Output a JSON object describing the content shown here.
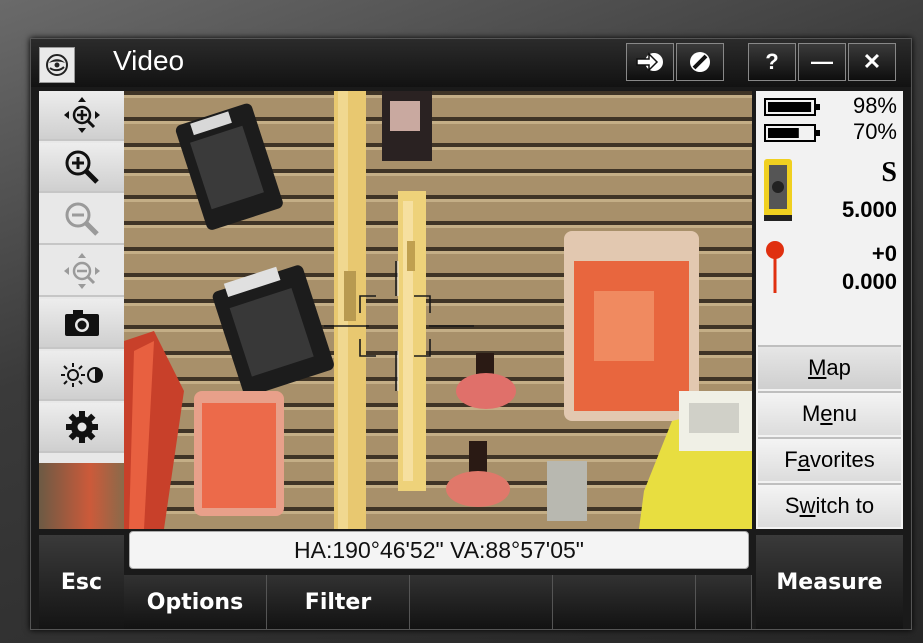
{
  "window": {
    "title": "Video"
  },
  "titlebar": {
    "help_label": "?",
    "minimize_label": "—",
    "close_label": "✕"
  },
  "toolbar": {
    "items": [
      {
        "name": "pan-tool",
        "icon": "pan-zoom-icon",
        "enabled": true
      },
      {
        "name": "zoom-in",
        "icon": "zoom-in-icon",
        "enabled": true
      },
      {
        "name": "zoom-out",
        "icon": "zoom-out-icon",
        "enabled": false
      },
      {
        "name": "zoom-extents",
        "icon": "zoom-extents-icon",
        "enabled": false
      },
      {
        "name": "camera",
        "icon": "camera-icon",
        "enabled": true
      },
      {
        "name": "brightness",
        "icon": "brightness-contrast-icon",
        "enabled": true
      },
      {
        "name": "settings",
        "icon": "gear-icon",
        "enabled": true
      }
    ]
  },
  "status_panel": {
    "battery1": "98%",
    "battery1_level": 0.98,
    "battery2": "70%",
    "battery2_level": 0.7,
    "instrument_face": "S",
    "instrument_value": "5.000",
    "target_offset": "+0",
    "target_height": "0.000"
  },
  "side_buttons": {
    "map": {
      "pre": "",
      "key": "M",
      "post": "ap"
    },
    "menu": {
      "pre": "M",
      "key": "e",
      "post": "nu"
    },
    "favorites": {
      "pre": "F",
      "key": "a",
      "post": "vorites"
    },
    "switch_to": {
      "pre": "S",
      "key": "w",
      "post": "itch to"
    }
  },
  "readout": {
    "text": "HA:190°46'52\"  VA:88°57'05\""
  },
  "softkeys": {
    "esc": "Esc",
    "measure": "Measure",
    "options": "Options",
    "filter": "Filter"
  },
  "colors": {
    "accent_target": "#e03010",
    "instrument_yellow": "#f0d020",
    "bar_dark": "#161616"
  }
}
